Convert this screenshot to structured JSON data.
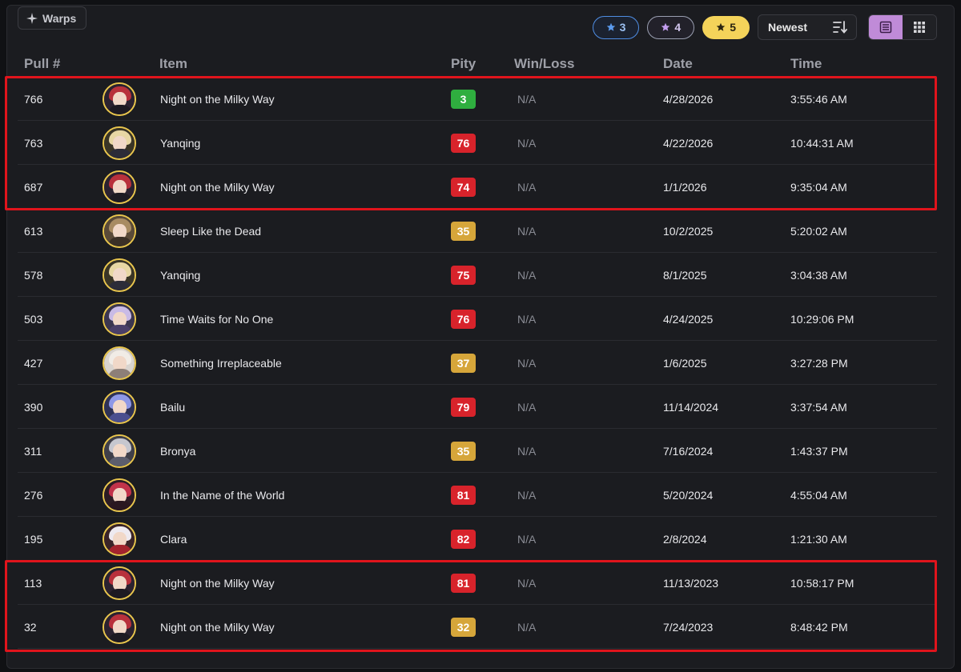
{
  "header": {
    "tab_label": "Warps",
    "tab_icon": "sparkle-icon",
    "filters": [
      {
        "label": "3",
        "rarity": "3-star",
        "color": "#4f8de3"
      },
      {
        "label": "4",
        "rarity": "4-star",
        "color": "#c39ef0"
      },
      {
        "label": "5",
        "rarity": "5-star",
        "color": "#f4d35a"
      }
    ],
    "sort_label": "Newest",
    "sort_icon": "sort-descending-icon",
    "view_modes": [
      {
        "name": "list-view",
        "active": true
      },
      {
        "name": "grid-view",
        "active": false
      }
    ],
    "accent_color": "#c08bd8"
  },
  "table": {
    "columns": [
      "Pull #",
      "Item",
      "Pity",
      "Win/Loss",
      "Date",
      "Time"
    ],
    "rows": [
      {
        "pull": "766",
        "item": "Night on the Milky Way",
        "avatar": "red-hair",
        "pity": "3",
        "pity_level": "green",
        "winloss": "N/A",
        "date": "4/28/2026",
        "time": "3:55:46 AM"
      },
      {
        "pull": "763",
        "item": "Yanqing",
        "avatar": "blonde",
        "pity": "76",
        "pity_level": "red",
        "winloss": "N/A",
        "date": "4/22/2026",
        "time": "10:44:31 AM"
      },
      {
        "pull": "687",
        "item": "Night on the Milky Way",
        "avatar": "red-hair",
        "pity": "74",
        "pity_level": "red",
        "winloss": "N/A",
        "date": "1/1/2026",
        "time": "9:35:04 AM"
      },
      {
        "pull": "613",
        "item": "Sleep Like the Dead",
        "avatar": "lightcone-brown",
        "pity": "35",
        "pity_level": "yellow",
        "winloss": "N/A",
        "date": "10/2/2025",
        "time": "5:20:02 AM"
      },
      {
        "pull": "578",
        "item": "Yanqing",
        "avatar": "blonde",
        "pity": "75",
        "pity_level": "red",
        "winloss": "N/A",
        "date": "8/1/2025",
        "time": "3:04:38 AM"
      },
      {
        "pull": "503",
        "item": "Time Waits for No One",
        "avatar": "lavender",
        "pity": "76",
        "pity_level": "red",
        "winloss": "N/A",
        "date": "4/24/2025",
        "time": "10:29:06 PM"
      },
      {
        "pull": "427",
        "item": "Something Irreplaceable",
        "avatar": "lightcone-white",
        "pity": "37",
        "pity_level": "yellow",
        "winloss": "N/A",
        "date": "1/6/2025",
        "time": "3:27:28 PM"
      },
      {
        "pull": "390",
        "item": "Bailu",
        "avatar": "blue-violet",
        "pity": "79",
        "pity_level": "red",
        "winloss": "N/A",
        "date": "11/14/2024",
        "time": "3:37:54 AM"
      },
      {
        "pull": "311",
        "item": "Bronya",
        "avatar": "silver",
        "pity": "35",
        "pity_level": "yellow",
        "winloss": "N/A",
        "date": "7/16/2024",
        "time": "1:43:37 PM"
      },
      {
        "pull": "276",
        "item": "In the Name of the World",
        "avatar": "dark-red",
        "pity": "81",
        "pity_level": "red",
        "winloss": "N/A",
        "date": "5/20/2024",
        "time": "4:55:04 AM"
      },
      {
        "pull": "195",
        "item": "Clara",
        "avatar": "white-red",
        "pity": "82",
        "pity_level": "red",
        "winloss": "N/A",
        "date": "2/8/2024",
        "time": "1:21:30 AM"
      },
      {
        "pull": "113",
        "item": "Night on the Milky Way",
        "avatar": "red-hair",
        "pity": "81",
        "pity_level": "red",
        "winloss": "N/A",
        "date": "11/13/2023",
        "time": "10:58:17 PM"
      },
      {
        "pull": "32",
        "item": "Night on the Milky Way",
        "avatar": "red-hair",
        "pity": "32",
        "pity_level": "yellow",
        "winloss": "N/A",
        "date": "7/24/2023",
        "time": "8:48:42 PM"
      }
    ]
  },
  "annotations": {
    "highlight_color": "#e0141c",
    "highlighted_rows": [
      [
        0,
        2
      ],
      [
        11,
        12
      ]
    ]
  }
}
